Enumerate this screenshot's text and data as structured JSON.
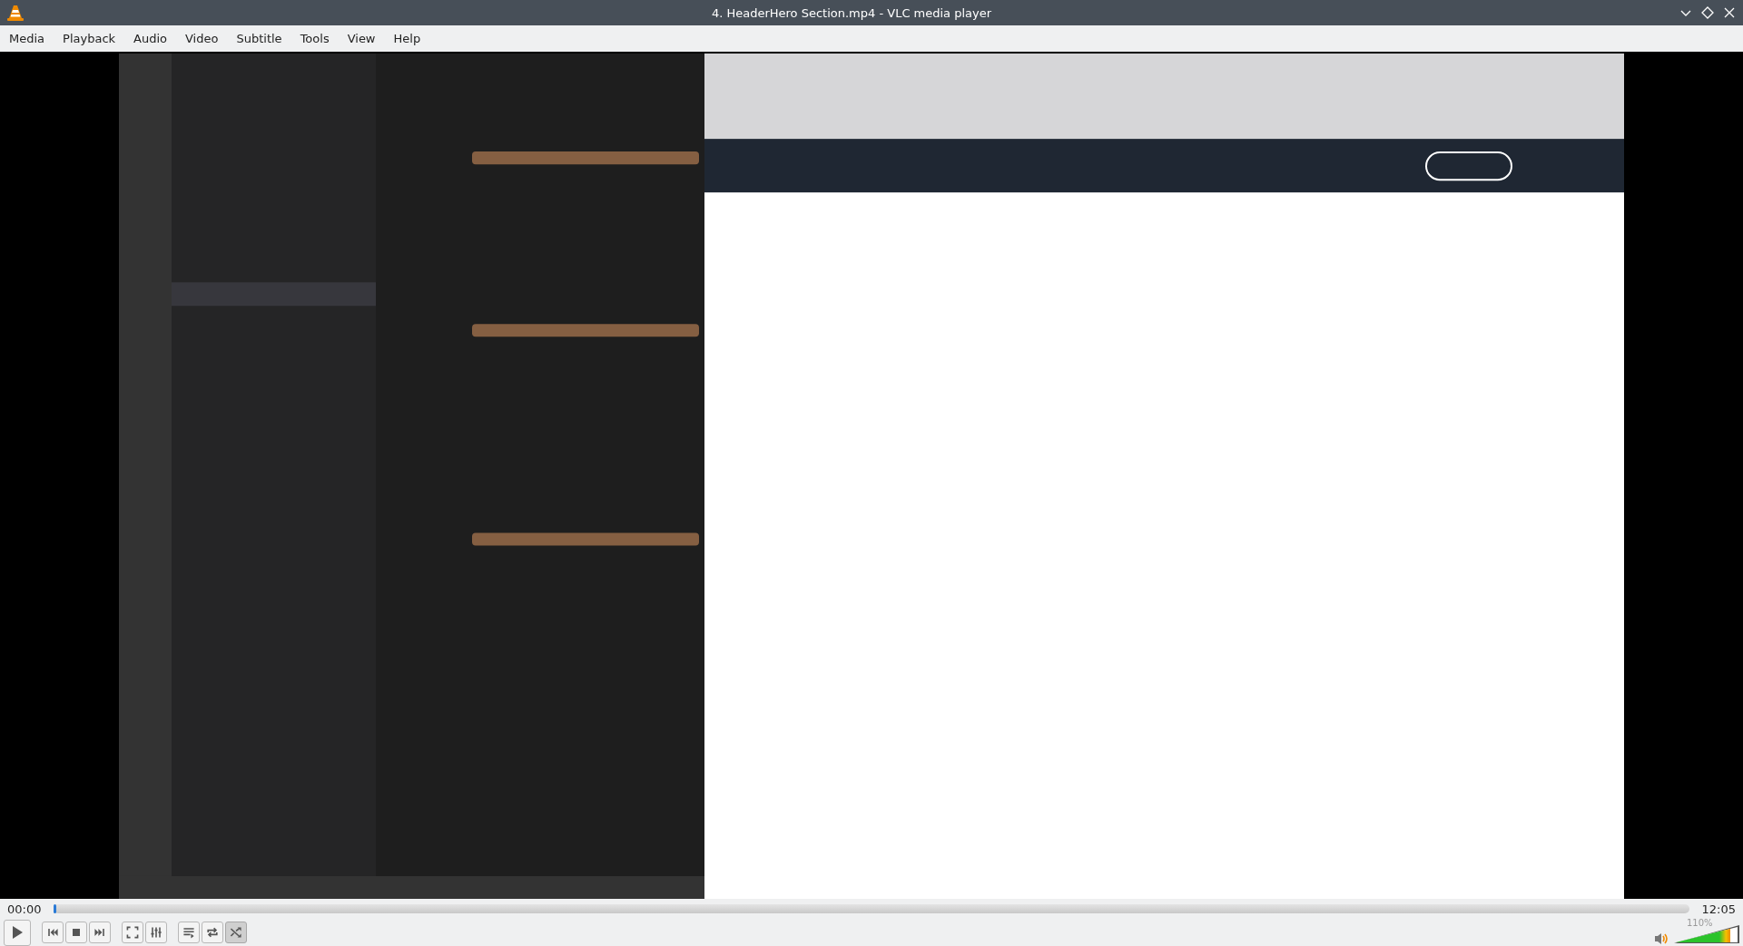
{
  "window": {
    "title": "4. HeaderHero Section.mp4 - VLC media player"
  },
  "menu": [
    {
      "label": "Media"
    },
    {
      "label": "Playback"
    },
    {
      "label": "Audio"
    },
    {
      "label": "Video"
    },
    {
      "label": "Subtitle"
    },
    {
      "label": "Tools"
    },
    {
      "label": "View"
    },
    {
      "label": "Help"
    }
  ],
  "seek": {
    "elapsed": "00:00",
    "total": "12:05",
    "level": 0
  },
  "controls": [
    {
      "kind": "play"
    },
    {
      "kind": "previous"
    },
    {
      "kind": "stop"
    },
    {
      "kind": "next"
    },
    {
      "kind": "fullscreen"
    },
    {
      "kind": "settings"
    },
    {
      "kind": "playlist"
    }
  ],
  "toggles": [
    {
      "kind": "loop",
      "on": false
    },
    {
      "kind": "shuffle",
      "on": true
    }
  ],
  "volume": {
    "reading": "110%",
    "level": 0.88
  }
}
